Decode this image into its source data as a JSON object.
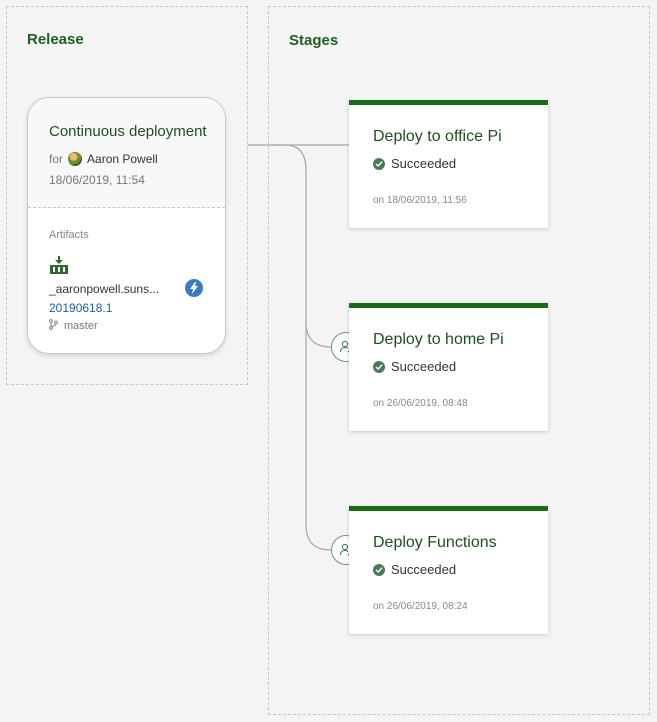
{
  "release": {
    "section_title": "Release",
    "card": {
      "title": "Continuous deployment",
      "for_label": "for",
      "author": "Aaron Powell",
      "date": "18/06/2019, 11:54",
      "artifacts_label": "Artifacts",
      "artifact_name": "_aaronpowell.suns...",
      "artifact_version": "20190618.1",
      "branch": "master"
    }
  },
  "stages": {
    "section_title": "Stages",
    "items": [
      {
        "name": "Deploy to office Pi",
        "status": "Succeeded",
        "date": "on 18/06/2019, 11:56"
      },
      {
        "name": "Deploy to home Pi",
        "status": "Succeeded",
        "date": "on 26/06/2019, 08:48"
      },
      {
        "name": "Deploy Functions",
        "status": "Succeeded",
        "date": "on 26/06/2019, 08:24"
      }
    ]
  },
  "colors": {
    "accent_green": "#1a6a1a",
    "status_check": "#4a7a5a",
    "link_blue": "#1f5fa0",
    "trigger_blue": "#3b7bbf"
  },
  "icons": {
    "author_avatar": "avatar",
    "artifact": "build-artifact-icon",
    "trigger": "lightning-icon",
    "branch": "branch-icon",
    "status": "check-circle-icon",
    "approver": "user-approval-icon"
  }
}
